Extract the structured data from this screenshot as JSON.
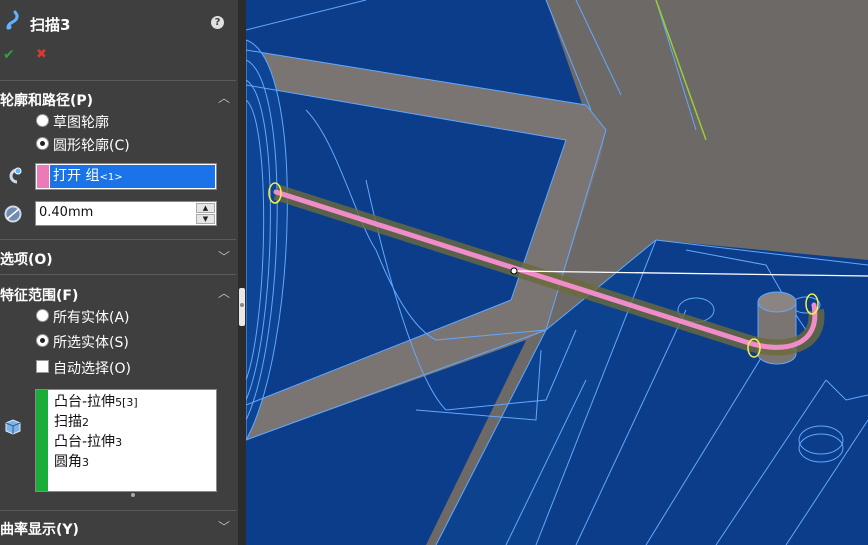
{
  "feature": {
    "title": "扫描3",
    "icons": {
      "title": "sweep-icon",
      "help": "help-icon",
      "ok": "checkmark-icon",
      "cancel": "close-icon"
    },
    "help_glyph": "?",
    "ok_glyph": "✔",
    "cancel_glyph": "✖"
  },
  "profile_path": {
    "header": "轮廓和路径(P)",
    "radio_sketch": "草图轮廓",
    "radio_circular": "圆形轮廓(C)",
    "selected_radio": "circular",
    "path_value": "打开 组",
    "path_suffix": "<1>",
    "path_swatch_color": "#ec7ab5",
    "diameter_value": "0.40mm"
  },
  "options": {
    "header": "选项(O)"
  },
  "feature_scope": {
    "header": "特征范围(F)",
    "radio_all": "所有实体(A)",
    "radio_selected": "所选实体(S)",
    "selected_radio": "selected",
    "auto_select": "自动选择(O)",
    "auto_select_checked": false,
    "bodies": [
      {
        "name": "凸台-拉伸",
        "suffix": "5[3]"
      },
      {
        "name": "扫描",
        "suffix": "2"
      },
      {
        "name": "凸台-拉伸",
        "suffix": "3"
      },
      {
        "name": "圆角",
        "suffix": "3"
      }
    ],
    "list_color": "#1aad3a"
  },
  "curvature": {
    "header": "曲率显示(Y)"
  },
  "colors": {
    "panel_bg": "#3f3f3f",
    "model_blue": "#0b3d8a",
    "model_gray": "#6d6967",
    "edge_blue": "#62a8ff",
    "sweep_path_pink": "#f08cc8",
    "highlight_yellow": "#f2f24a"
  }
}
